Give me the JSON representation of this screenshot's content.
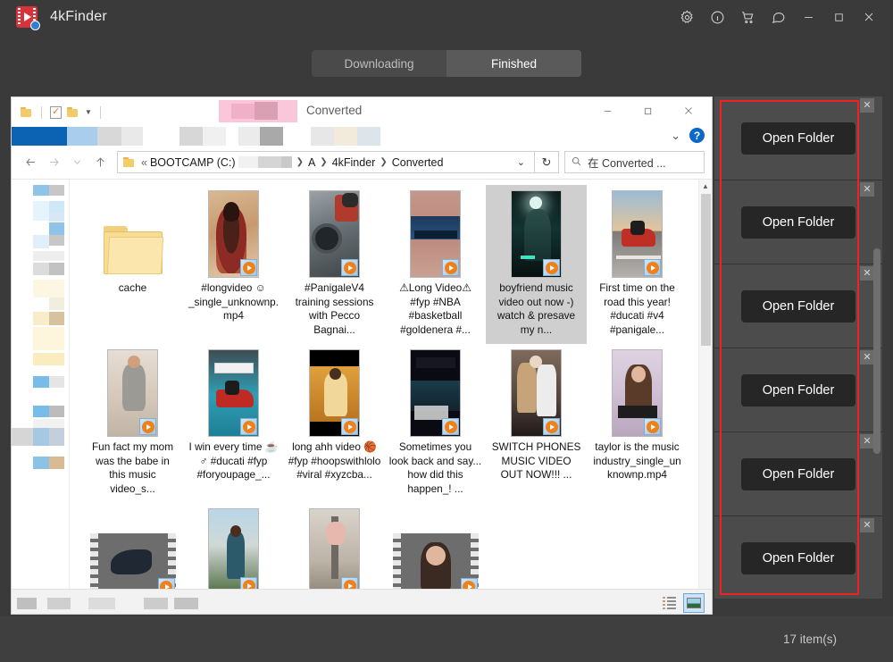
{
  "app": {
    "title": "4kFinder",
    "logo_icon": "video-finder-logo",
    "titlebar_icons": [
      {
        "name": "settings-icon",
        "glyph": "gear"
      },
      {
        "name": "info-icon",
        "glyph": "info"
      },
      {
        "name": "cart-icon",
        "glyph": "cart"
      },
      {
        "name": "feedback-icon",
        "glyph": "chat"
      },
      {
        "name": "minimize-icon",
        "glyph": "minimize"
      },
      {
        "name": "maximize-icon",
        "glyph": "maximize"
      },
      {
        "name": "close-icon",
        "glyph": "close"
      }
    ],
    "tabs": [
      {
        "label": "Downloading",
        "active": false
      },
      {
        "label": "Finished",
        "active": true
      }
    ],
    "status": {
      "item_count": "17 item(s)"
    },
    "colors": {
      "background": "#3a3a3a",
      "tab_active": "#5a5a5a",
      "accent_red": "#d8323a",
      "highlight_border": "#f41f1f",
      "button_dark": "#262626"
    }
  },
  "explorer": {
    "window_title": "Converted",
    "quick_access": {
      "folder_icon": "folder-icon",
      "properties_icon": "properties-icon",
      "new_folder_icon": "new-folder-icon",
      "customize_caret": "chevron-down-icon"
    },
    "window_controls": [
      {
        "name": "explorer-minimize-icon",
        "glyph": "—"
      },
      {
        "name": "explorer-maximize-icon",
        "glyph": "▢"
      },
      {
        "name": "explorer-close-icon",
        "glyph": "✕"
      }
    ],
    "ribbon_controls": {
      "expand_caret": "chevron-down-icon",
      "help_label": "?"
    },
    "navigation": {
      "back": "←",
      "forward": "→",
      "recent": "⌄",
      "up": "↑"
    },
    "breadcrumb": {
      "folder_icon": "folder-icon",
      "lead": "«",
      "items": [
        "BOOTCAMP (C:)",
        "[blurred]",
        "A",
        "4kFinder",
        "Converted"
      ],
      "caret": "⌄"
    },
    "refresh_label": "↻",
    "search": {
      "icon": "search-icon",
      "value": "在 Converted ..."
    },
    "view_toggles": [
      {
        "name": "details-view-button",
        "active": false
      },
      {
        "name": "large-icons-view-button",
        "active": true
      }
    ],
    "files": [
      {
        "label": "cache",
        "type": "folder",
        "selected": false
      },
      {
        "label": "#longvideo ☺_single_unknownp.mp4",
        "type": "video",
        "selected": false
      },
      {
        "label": "#PanigaleV4 training sessions with Pecco Bagnai...",
        "type": "video",
        "selected": false
      },
      {
        "label": "⚠Long Video⚠ #fyp #NBA #basketball #goldenera #...",
        "type": "video",
        "selected": false
      },
      {
        "label": "boyfriend music video out now -) watch & presave my n...",
        "type": "video",
        "selected": true
      },
      {
        "label": "First time on the road this year! #ducati #v4 #panigale...",
        "type": "video",
        "selected": false
      },
      {
        "label": "Fun fact my mom was the babe in this music video_s...",
        "type": "video",
        "selected": false
      },
      {
        "label": "I win every time ☕♂ #ducati #fyp #foryoupage_...",
        "type": "video",
        "selected": false
      },
      {
        "label": "long ahh video 🏀 #fyp #hoopswithlolo #viral #xyzcba...",
        "type": "video",
        "selected": false
      },
      {
        "label": "Sometimes you look back and say... how did this happen_! ...",
        "type": "video",
        "selected": false
      },
      {
        "label": "SWITCH PHONES MUSIC VIDEO OUT NOW!!! ...",
        "type": "video",
        "selected": false
      },
      {
        "label": "taylor is the music industry_single_unknownp.mp4",
        "type": "video",
        "selected": false
      },
      {
        "label": "",
        "type": "video-film",
        "selected": false
      },
      {
        "label": "",
        "type": "video",
        "selected": false
      },
      {
        "label": "",
        "type": "video",
        "selected": false
      },
      {
        "label": "",
        "type": "video-film",
        "selected": false
      }
    ]
  },
  "right_panel": {
    "items": [
      {
        "button_label": "Open Folder",
        "close_icon": "close-icon"
      },
      {
        "button_label": "Open Folder",
        "close_icon": "close-icon"
      },
      {
        "button_label": "Open Folder",
        "close_icon": "close-icon"
      },
      {
        "button_label": "Open Folder",
        "close_icon": "close-icon"
      },
      {
        "button_label": "Open Folder",
        "close_icon": "close-icon"
      },
      {
        "button_label": "Open Folder",
        "close_icon": "close-icon"
      }
    ]
  }
}
